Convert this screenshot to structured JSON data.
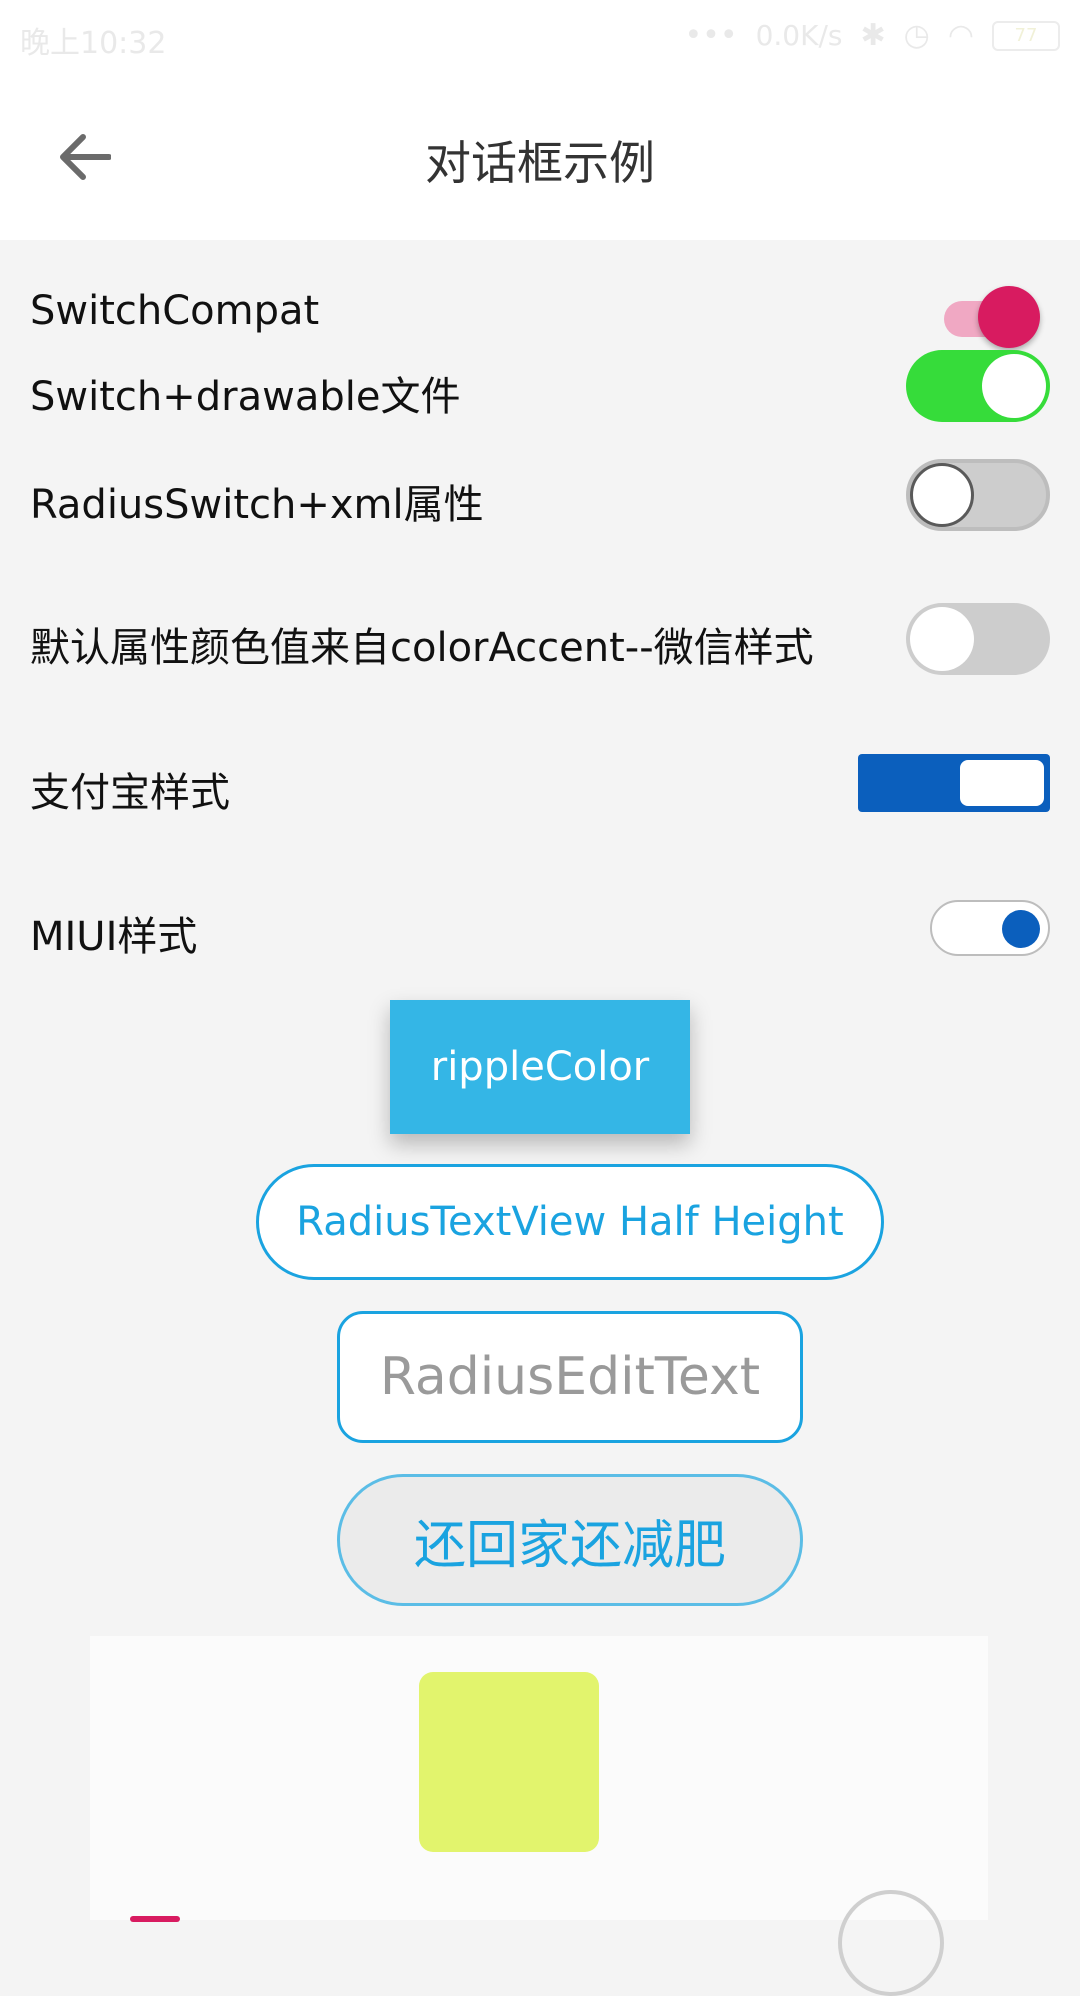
{
  "status_bar": {
    "time": "晚上10:32",
    "speed": "0.0K/s",
    "battery": "77"
  },
  "appbar": {
    "title": "对话框示例"
  },
  "rows": [
    {
      "label": "SwitchCompat",
      "checked": true,
      "accent": "#d81b60"
    },
    {
      "label": "Switch+drawable文件",
      "checked": true,
      "accent": "#36dc3a"
    },
    {
      "label": "RadiusSwitch+xml属性",
      "checked": false
    },
    {
      "label": "默认属性颜色值来自colorAccent--微信样式",
      "checked": false
    },
    {
      "label": "支付宝样式",
      "checked": true,
      "accent": "#0b5fbd"
    },
    {
      "label": "MIUI样式",
      "checked": true,
      "accent": "#0b5fbd"
    }
  ],
  "buttons": {
    "ripple": "rippleColor",
    "radius_textview": "RadiusTextView Half Height",
    "radius_edittext_placeholder": "RadiusEditText",
    "pill": "还回家还减肥"
  },
  "colors": {
    "ripple_bg": "#34b6e6",
    "link_blue": "#1aa3e0",
    "square": "#e2f46d"
  }
}
